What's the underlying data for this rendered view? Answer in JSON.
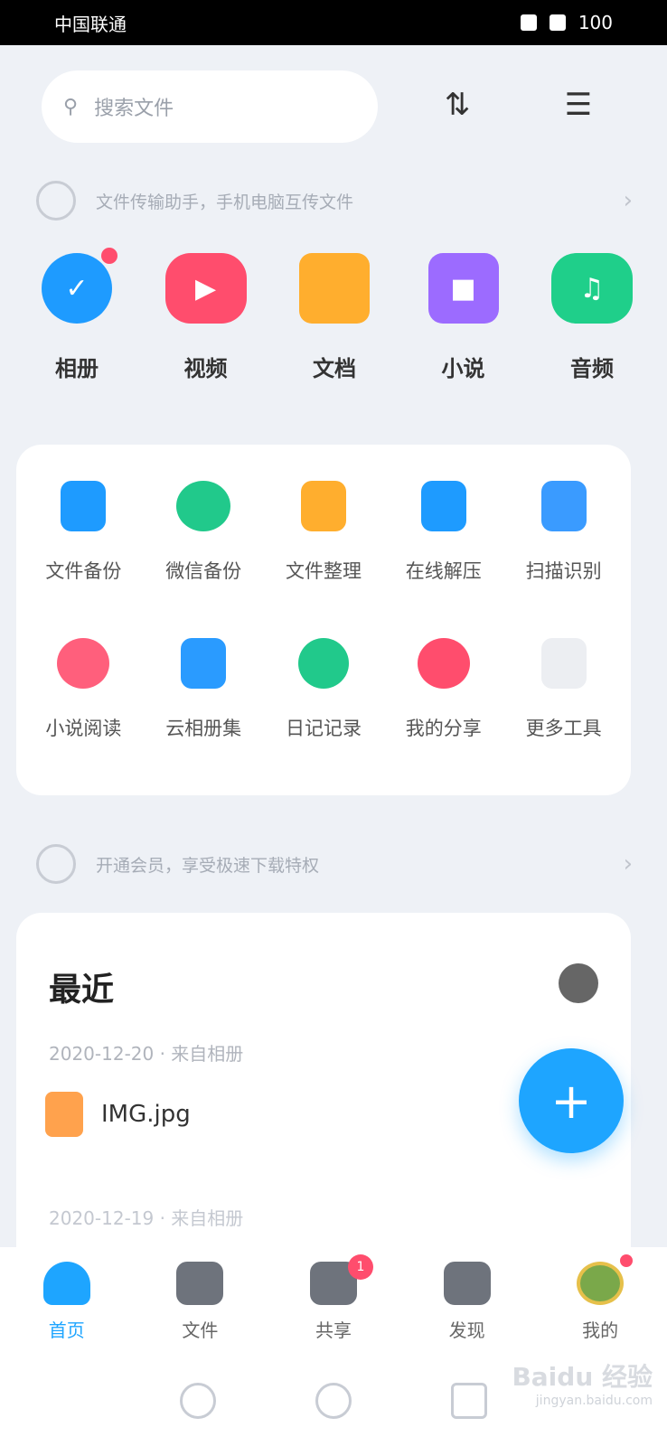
{
  "status_bar": {
    "left": "中国联通",
    "right": "100"
  },
  "search": {
    "placeholder": "搜索文件"
  },
  "notice_top": {
    "text": "文件传输助手，手机电脑互传文件"
  },
  "categories": [
    {
      "label": "相册",
      "color": "#1e9bff",
      "shape": "circle",
      "badge": true
    },
    {
      "label": "视频",
      "color": "#ff4d6d",
      "shape": "rounded",
      "badge": false
    },
    {
      "label": "文档",
      "color": "#ffae2e",
      "shape": "folder",
      "badge": false
    },
    {
      "label": "小说",
      "color": "#9c6bff",
      "shape": "book",
      "badge": false
    },
    {
      "label": "音频",
      "color": "#1fcf8a",
      "shape": "rounded",
      "badge": false
    }
  ],
  "tools": [
    {
      "label": "文件备份",
      "color": "#1e9bff"
    },
    {
      "label": "微信备份",
      "color": "#21c98b"
    },
    {
      "label": "文件整理",
      "color": "#ffae2e"
    },
    {
      "label": "在线解压",
      "color": "#1e9bff"
    },
    {
      "label": "扫描识别",
      "color": "#3a9bff"
    },
    {
      "label": "小说阅读",
      "color": "#ff5f7c"
    },
    {
      "label": "云相册集",
      "color": "#2a9bff"
    },
    {
      "label": "日记记录",
      "color": "#21c98b"
    },
    {
      "label": "我的分享",
      "color": "#ff4d6d"
    },
    {
      "label": "更多工具",
      "color": "#d8dbe0"
    }
  ],
  "notice_mid": {
    "text": "开通会员，享受极速下载特权"
  },
  "recent": {
    "title": "最近",
    "date1": "2020-12-20 · 来自相册",
    "file_name": "IMG.jpg",
    "date2": "2020-12-19 · 来自相册"
  },
  "fab": {
    "label": "+"
  },
  "bottom_nav": [
    {
      "label": "首页",
      "active": true,
      "badge": ""
    },
    {
      "label": "文件",
      "active": false,
      "badge": ""
    },
    {
      "label": "共享",
      "active": false,
      "badge": "1"
    },
    {
      "label": "发现",
      "active": false,
      "badge": ""
    },
    {
      "label": "我的",
      "active": false,
      "badge": ""
    }
  ],
  "watermark": {
    "text": "Baidu 经验",
    "url": "jingyan.baidu.com"
  }
}
